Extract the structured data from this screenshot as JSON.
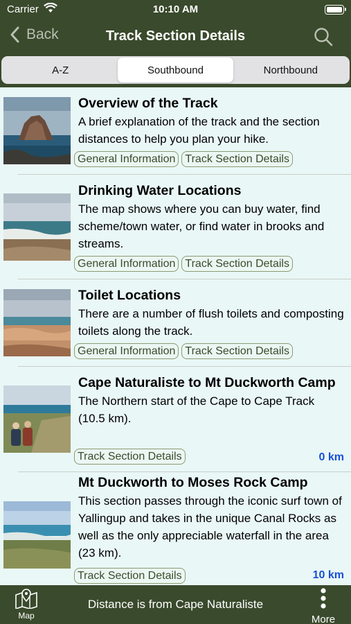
{
  "status": {
    "carrier": "Carrier",
    "time": "10:10 AM"
  },
  "nav": {
    "back_label": "Back",
    "title": "Track Section Details"
  },
  "segments": [
    {
      "label": "A-Z",
      "active": false
    },
    {
      "label": "Southbound",
      "active": true
    },
    {
      "label": "Northbound",
      "active": false
    }
  ],
  "items": [
    {
      "title": "Overview of the Track",
      "desc": "A brief explanation of the track and the section distances to help you plan your hike.",
      "tags": [
        "General Information",
        "Track Section Details"
      ],
      "distance": ""
    },
    {
      "title": "Drinking Water Locations",
      "desc": "The map shows where you can buy water, find scheme/town water, or find water in brooks and streams.",
      "tags": [
        "General Information",
        "Track Section Details"
      ],
      "distance": ""
    },
    {
      "title": "Toilet Locations",
      "desc": "There are a number of flush toilets and composting toilets along the track.",
      "tags": [
        "General Information",
        "Track Section Details"
      ],
      "distance": ""
    },
    {
      "title": "Cape Naturaliste to Mt Duckworth Camp",
      "desc": "The Northern start of the Cape to Cape Track (10.5 km).",
      "tags": [
        "Track Section Details"
      ],
      "distance": "0 km"
    },
    {
      "title": "Mt Duckworth to Moses Rock Camp",
      "desc": "This section passes through the iconic surf town of Yallingup and takes in the unique Canal Rocks as well as the only appreciable waterfall in the area (23 km).",
      "tags": [
        "Track Section Details"
      ],
      "distance": "10 km"
    }
  ],
  "footer": {
    "map_label": "Map",
    "text": "Distance is from Cape Naturaliste",
    "more_label": "More"
  },
  "colors": {
    "bar": "#3a4a2c",
    "list_bg": "#e9f7f6",
    "distance": "#1a4fd8"
  }
}
